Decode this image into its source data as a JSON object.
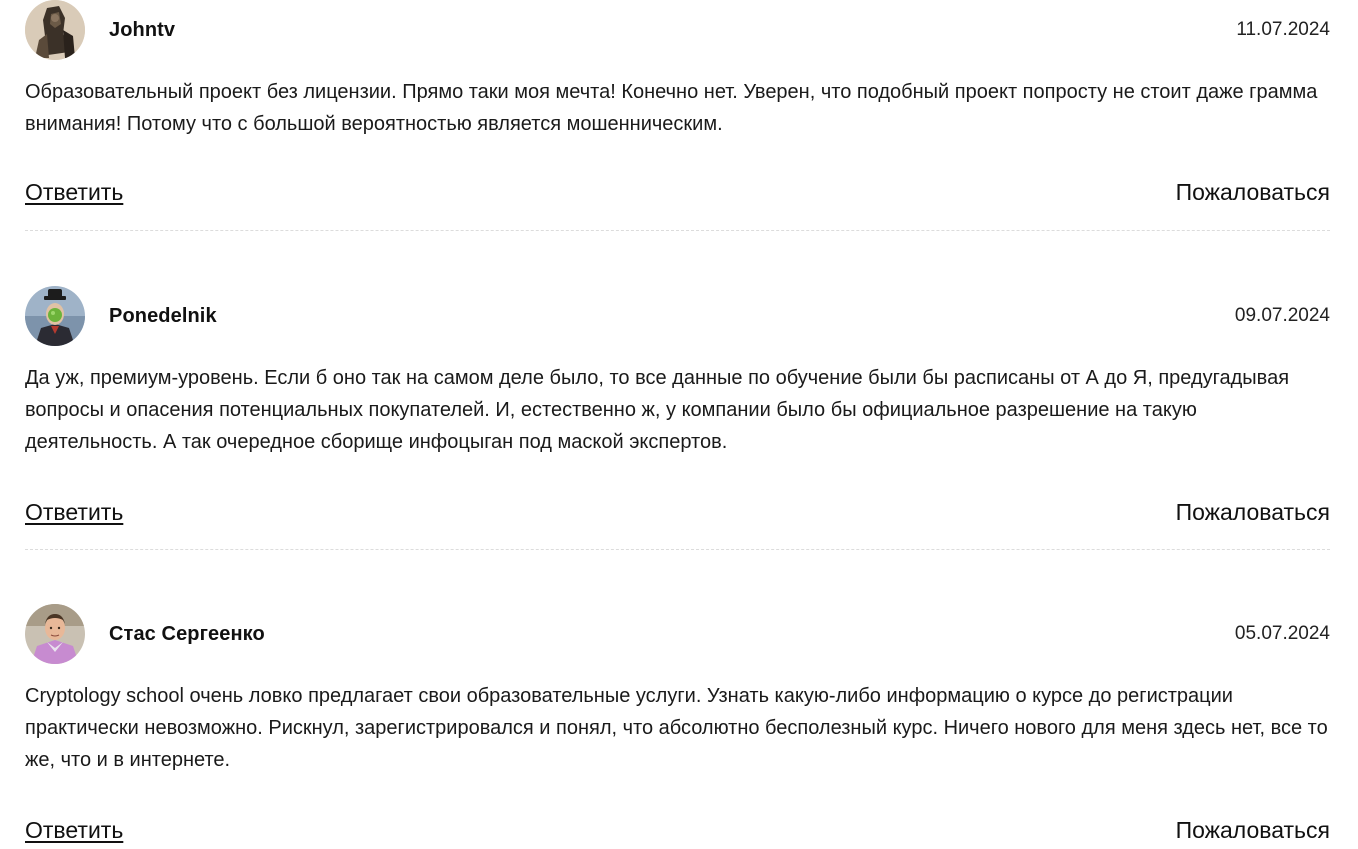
{
  "comments": [
    {
      "author": "Johntv",
      "date": "11.07.2024",
      "avatar_icon": "avatar-photo-icon",
      "text": "Образовательный проект без лицензии. Прямо таки моя мечта! Конечно нет. Уверен, что подобный проект попросту не стоит даже грамма внимания! Потому что с большой вероятностью является мошенническим.",
      "reply_label": "Ответить",
      "report_label": "Пожаловаться"
    },
    {
      "author": "Ponedelnik",
      "date": "09.07.2024",
      "avatar_icon": "avatar-photo-icon",
      "text": "Да уж, премиум-уровень. Если б оно так на самом деле было, то все данные по обучение были бы расписаны от А до Я, предугадывая вопросы и опасения потенциальных покупателей. И, естественно ж, у компании было бы официальное разрешение на такую деятельность. А так очередное сборище инфоцыган под маской экспертов.",
      "reply_label": "Ответить",
      "report_label": "Пожаловаться"
    },
    {
      "author": "Стас Сергеенко",
      "date": "05.07.2024",
      "avatar_icon": "avatar-photo-icon",
      "text": "Cryptology school очень ловко предлагает свои образовательные услуги. Узнать какую-либо информацию о курсе до регистрации практически невозможно. Рискнул, зарегистрировался и понял, что абсолютно бесполезный курс. Ничего нового для меня здесь нет, все то же, что и в интернете.",
      "reply_label": "Ответить",
      "report_label": "Пожаловаться"
    }
  ]
}
